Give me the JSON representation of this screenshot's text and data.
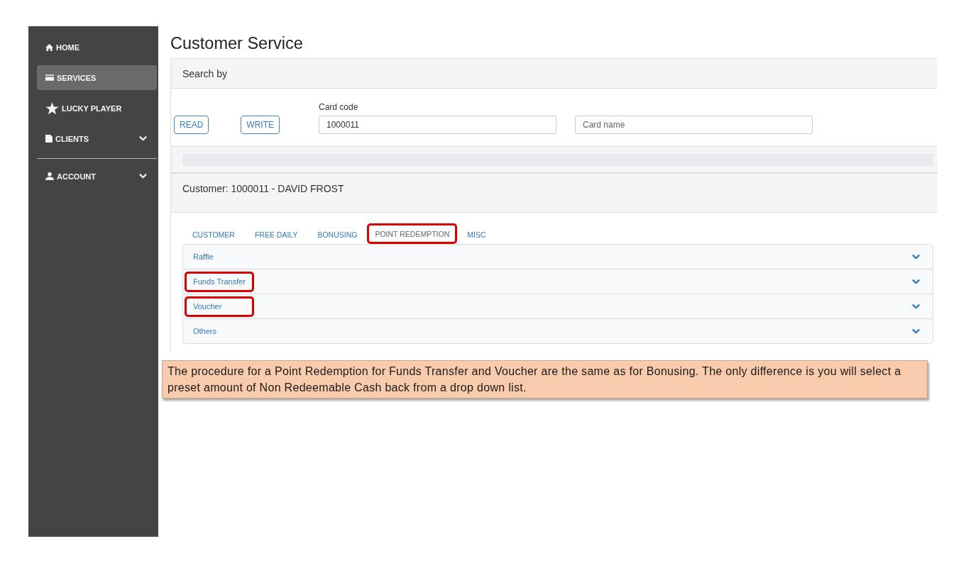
{
  "sidebar": {
    "sections": [
      {
        "items": [
          {
            "label": "HOME",
            "kind": "link",
            "selected": false
          },
          {
            "label": "SERVICES",
            "kind": "link",
            "selected": true
          },
          {
            "label": "LUCKY PLAYER",
            "kind": "link",
            "selected": false
          },
          {
            "label": "CLIENTS",
            "kind": "menu",
            "selected": false
          }
        ]
      },
      {
        "items": [
          {
            "label": "ACCOUNT",
            "kind": "menu",
            "selected": false
          }
        ]
      }
    ]
  },
  "page_title": "Customer Service",
  "search_panel": {
    "title": "Search by",
    "buttons": [
      "READ",
      "WRITE"
    ],
    "fields": [
      {
        "label": "Card code",
        "value": "1000011"
      },
      {
        "placeholder": "Card name"
      }
    ]
  },
  "customer_panel": {
    "title": "Customer: 1000011 - DAVID FROST",
    "tabs": [
      {
        "label": "CUSTOMER",
        "selected": false,
        "highlighted": false
      },
      {
        "label": "FREE DAILY",
        "selected": false,
        "highlighted": false
      },
      {
        "label": "BONUSING",
        "selected": false,
        "highlighted": false
      },
      {
        "label": "POINT REDEMPTION",
        "selected": true,
        "highlighted": true
      },
      {
        "label": "MISC",
        "selected": false,
        "highlighted": false
      }
    ],
    "accordion": [
      {
        "title": "Raffle",
        "expanded": false,
        "highlighted": false
      },
      {
        "title": "Funds Transfer",
        "expanded": false,
        "highlighted": true
      },
      {
        "title": "Voucher",
        "expanded": false,
        "highlighted": true
      },
      {
        "title": "Others",
        "expanded": false,
        "highlighted": false
      }
    ]
  },
  "note": "The procedure for a Point Redemption for Funds Transfer and Voucher are the same as for Bonusing. The only difference is you will select a preset amount of Non Redeemable Cash back from a drop down list."
}
